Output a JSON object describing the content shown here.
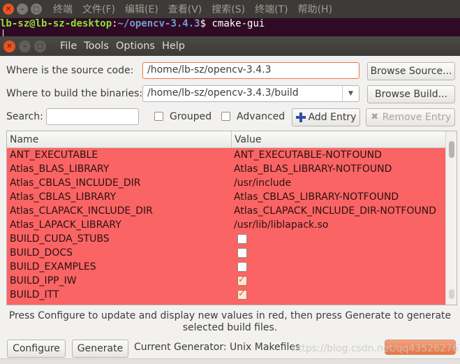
{
  "terminal": {
    "menu": [
      "终端",
      "文件(F)",
      "编辑(E)",
      "查看(V)",
      "搜索(S)",
      "终端(T)",
      "帮助(H)"
    ],
    "prompt_user": "lb-sz@lb-sz-desktop",
    "prompt_sep": ":",
    "prompt_path": "~/opencv-3.4.3",
    "prompt_symbol": "$",
    "command": "cmake-gui"
  },
  "app_menu": [
    "File",
    "Tools",
    "Options",
    "Help"
  ],
  "source": {
    "label": "Where is the source code:",
    "value": "/home/lb-sz/opencv-3.4.3",
    "browse_label": "Browse Source..."
  },
  "build": {
    "label": "Where to build the binaries:",
    "value": "/home/lb-sz/opencv-3.4.3/build",
    "browse_label": "Browse Build..."
  },
  "search": {
    "label": "Search:",
    "value": "",
    "grouped_label": "Grouped",
    "advanced_label": "Advanced",
    "add_entry_label": "Add Entry",
    "remove_entry_label": "Remove Entry"
  },
  "table": {
    "columns": [
      "Name",
      "Value"
    ],
    "rows": [
      {
        "name": "ANT_EXECUTABLE",
        "value": "ANT_EXECUTABLE-NOTFOUND"
      },
      {
        "name": "Atlas_BLAS_LIBRARY",
        "value": "Atlas_BLAS_LIBRARY-NOTFOUND"
      },
      {
        "name": "Atlas_CBLAS_INCLUDE_DIR",
        "value": "/usr/include"
      },
      {
        "name": "Atlas_CBLAS_LIBRARY",
        "value": "Atlas_CBLAS_LIBRARY-NOTFOUND"
      },
      {
        "name": "Atlas_CLAPACK_INCLUDE_DIR",
        "value": "Atlas_CLAPACK_INCLUDE_DIR-NOTFOUND"
      },
      {
        "name": "Atlas_LAPACK_LIBRARY",
        "value": "/usr/lib/liblapack.so"
      },
      {
        "name": "BUILD_CUDA_STUBS",
        "checkbox": false
      },
      {
        "name": "BUILD_DOCS",
        "checkbox": false
      },
      {
        "name": "BUILD_EXAMPLES",
        "checkbox": false
      },
      {
        "name": "BUILD_IPP_IW",
        "checkbox": true
      },
      {
        "name": "BUILD_ITT",
        "checkbox": true
      }
    ],
    "highlight_color": "#fa6464"
  },
  "hint": {
    "line1": "Press Configure to update and display new values in red, then press Generate to generate",
    "line2": "selected build files."
  },
  "footer": {
    "configure_label": "Configure",
    "generate_label": "Generate",
    "generator_text": "Current Generator: Unix Makefiles"
  },
  "watermark": "https://blog.csdn.net/qq435262767",
  "colors": {
    "accent": "#e95420",
    "terminal_bg": "#300a24",
    "titlebar": "#3c3b37"
  }
}
